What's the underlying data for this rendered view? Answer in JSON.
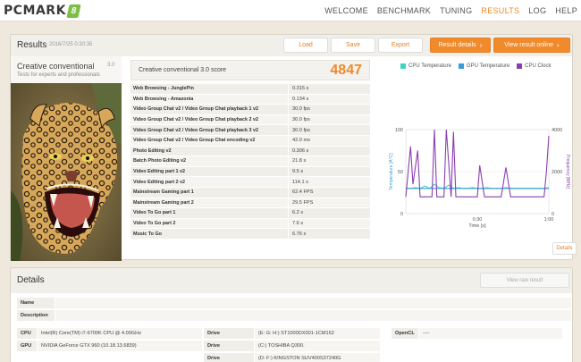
{
  "nav": {
    "logo": "PCMARK",
    "logo_badge": "8",
    "items": [
      "WELCOME",
      "BENCHMARK",
      "TUNING",
      "RESULTS",
      "LOG",
      "HELP"
    ],
    "active": "RESULTS"
  },
  "results": {
    "title": "Results",
    "date": "2016/7/25 0:30:35",
    "buttons": {
      "load": "Load",
      "save": "Save",
      "export": "Export",
      "result_details": "Result details",
      "view_online": "View result online"
    },
    "test": {
      "name": "Creative conventional",
      "version": "3.0",
      "description": "Tests for experts and professionals"
    },
    "score_label": "Creative conventional 3.0 score",
    "score": "4847",
    "subtests": [
      {
        "name": "Web Browsing - JunglePin",
        "value": "0.315 s"
      },
      {
        "name": "Web Browsing - Amazonia",
        "value": "0.134 s"
      },
      {
        "name": "Video Group Chat v2 / Video Group Chat playback 1 v2",
        "value": "30.0 fps"
      },
      {
        "name": "Video Group Chat v2 / Video Group Chat playback 2 v2",
        "value": "30.0 fps"
      },
      {
        "name": "Video Group Chat v2 / Video Group Chat playback 3 v2",
        "value": "30.0 fps"
      },
      {
        "name": "Video Group Chat v2 / Video Group Chat encoding v2",
        "value": "42.0 ms"
      },
      {
        "name": "Photo Editing v2",
        "value": "0.306 s"
      },
      {
        "name": "Batch Photo Editing v2",
        "value": "21.8 s"
      },
      {
        "name": "Video Editing part 1 v2",
        "value": "9.5 s"
      },
      {
        "name": "Video Editing part 2 v2",
        "value": "114.1 s"
      },
      {
        "name": "Mainstream Gaming part 1",
        "value": "62.4 FPS"
      },
      {
        "name": "Mainstream Gaming part 2",
        "value": "29.5 FPS"
      },
      {
        "name": "Video To Go part 1",
        "value": "6.2 s"
      },
      {
        "name": "Video To Go part 2",
        "value": "7.6 s"
      },
      {
        "name": "Music To Go",
        "value": "6.76 s"
      }
    ],
    "details_button": "Details"
  },
  "chart_data": {
    "type": "line",
    "xlabel": "Time [s]",
    "ylabel_left": "Temperature [A°C]",
    "ylabel_right": "Frequency [MHz]",
    "x_ticks": [
      "0:30",
      "1:00"
    ],
    "y_left_ticks": [
      "100",
      "50",
      "0"
    ],
    "y_right_ticks": [
      "4000",
      "2000",
      "0"
    ],
    "y_left_range": [
      0,
      100
    ],
    "y_right_range": [
      0,
      4000
    ],
    "x_range": [
      0,
      60
    ],
    "legend": [
      {
        "name": "CPU Temperature",
        "color": "#3dd6c2"
      },
      {
        "name": "GPU Temperature",
        "color": "#3b9bd6"
      },
      {
        "name": "CPU Clock",
        "color": "#8a3fb0"
      }
    ],
    "series": [
      {
        "name": "CPU Temperature",
        "axis": "left",
        "x": [
          0,
          2,
          4,
          6,
          8,
          10,
          12,
          14,
          16,
          18,
          20,
          22,
          24,
          26,
          28,
          30,
          32,
          34,
          36,
          38,
          40,
          42,
          44,
          46,
          48,
          50,
          52,
          54,
          56,
          58,
          60
        ],
        "y": [
          30,
          30,
          31,
          30,
          33,
          30,
          35,
          31,
          30,
          34,
          30,
          31,
          30,
          30,
          31,
          30,
          30,
          31,
          30,
          30,
          30,
          31,
          30,
          30,
          30,
          30,
          30,
          30,
          30,
          30,
          31
        ]
      },
      {
        "name": "GPU Temperature",
        "axis": "left",
        "x": [
          0,
          10,
          20,
          30,
          40,
          50,
          60
        ],
        "y": [
          30,
          30,
          30,
          30,
          30,
          30,
          30
        ]
      },
      {
        "name": "CPU Clock",
        "axis": "right",
        "x": [
          0,
          2,
          3,
          5,
          6,
          8,
          9,
          11,
          12,
          13,
          15,
          16,
          17,
          19,
          20,
          21,
          23,
          25,
          27,
          29,
          30,
          31,
          33,
          35,
          37,
          38,
          40,
          42,
          44,
          46,
          48,
          50,
          52,
          54,
          56,
          58,
          59,
          60
        ],
        "y": [
          800,
          3200,
          1400,
          3000,
          800,
          800,
          800,
          800,
          4000,
          800,
          800,
          800,
          4000,
          800,
          3900,
          800,
          800,
          800,
          800,
          800,
          800,
          2300,
          800,
          800,
          800,
          800,
          800,
          2200,
          800,
          800,
          800,
          800,
          800,
          800,
          800,
          800,
          2000,
          3700
        ]
      }
    ]
  },
  "details": {
    "title": "Details",
    "view_raw": "View raw result",
    "name_label": "Name",
    "description_label": "Description",
    "cpu_label": "CPU",
    "cpu_value": "Intel(R) Core(TM) i7-6700K CPU @ 4.00GHz",
    "gpu_label": "GPU",
    "gpu_value": "NVIDIA GeForce GTX 960 (10.18.13.6839)",
    "drive_label": "Drive",
    "drives": [
      "(E: G: H:) ST1000DX001-1CM162",
      "(C:) TOSHIBA Q300.",
      "(D: F:) KINGSTON SUV400S37240G"
    ],
    "opencl_label": "OpenCL",
    "opencl_value": "----"
  }
}
